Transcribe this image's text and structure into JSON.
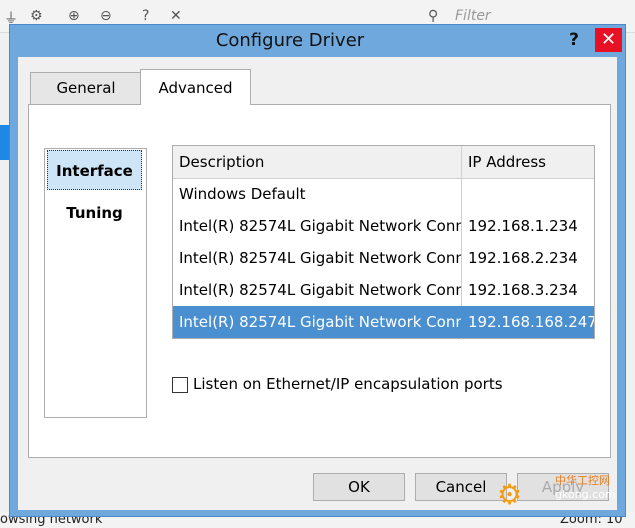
{
  "background": {
    "filter_placeholder": "Filter",
    "status_left": "owsing network",
    "status_right": "Zoom: 10"
  },
  "dialog": {
    "title": "Configure Driver",
    "help_label": "?",
    "close_label": "✕",
    "tabs": [
      {
        "label": "General",
        "active": false
      },
      {
        "label": "Advanced",
        "active": true
      }
    ],
    "side_nav": [
      {
        "label": "Interface",
        "selected": true
      },
      {
        "label": "Tuning",
        "selected": false
      }
    ],
    "table": {
      "headers": [
        "Description",
        "IP Address"
      ],
      "rows": [
        {
          "description": "Windows Default",
          "ip": ""
        },
        {
          "description": "Intel(R) 82574L Gigabit Network Conn",
          "ip": "192.168.1.234"
        },
        {
          "description": "Intel(R) 82574L Gigabit Network Conn",
          "ip": "192.168.2.234"
        },
        {
          "description": "Intel(R) 82574L Gigabit Network Conn",
          "ip": "192.168.3.234"
        },
        {
          "description": "Intel(R) 82574L Gigabit Network Conn",
          "ip": "192.168.168.247"
        }
      ],
      "selected_index": 4
    },
    "checkbox": {
      "label": "Listen on Ethernet/IP encapsulation ports",
      "checked": false
    },
    "buttons": {
      "ok": "OK",
      "cancel": "Cancel",
      "apply": "Apply"
    }
  },
  "watermark": {
    "line1": "中华工控网",
    "line2": "gkong.com"
  },
  "colors": {
    "titlebar": "#6fa8dc",
    "close": "#e81123",
    "selection": "#4a8fd0"
  }
}
